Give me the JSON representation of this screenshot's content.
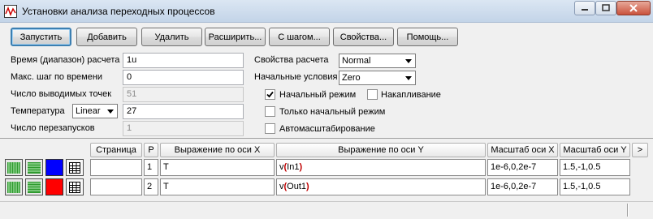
{
  "window": {
    "title": "Установки анализа переходных процессов"
  },
  "toolbar": {
    "run": "Запустить",
    "add": "Добавить",
    "delete": "Удалить",
    "expand": "Расширить...",
    "step": "С шагом...",
    "properties": "Свойства...",
    "help": "Помощь..."
  },
  "params": {
    "time_range_label": "Время (диапазон) расчета",
    "time_range_value": "1u",
    "max_step_label": "Макс.  шаг по времени",
    "max_step_value": "0",
    "points_label": "Число выводимых точек",
    "points_value": "51",
    "temperature_label": "Температура",
    "temperature_mode": "Linear",
    "temperature_value": "27",
    "restarts_label": "Число перезапусков",
    "restarts_value": "1"
  },
  "options": {
    "calc_props_label": "Свойства расчета",
    "calc_props_value": "Normal",
    "initial_cond_label": "Начальные условия",
    "initial_cond_value": "Zero",
    "initial_mode_label": "Начальный режим",
    "initial_mode_checked": true,
    "accumulate_label": "Накапливание",
    "accumulate_checked": false,
    "only_initial_label": "Только начальный режим",
    "only_initial_checked": false,
    "autoscale_label": "Автомасштабирование",
    "autoscale_checked": false
  },
  "table": {
    "headers": {
      "page": "Страница",
      "p": "P",
      "x_expr": "Выражение по оси X",
      "y_expr": "Выражение по оси Y",
      "x_scale": "Масштаб оси X",
      "y_scale": "Масштаб оси Y",
      "more": ">"
    },
    "rows": [
      {
        "color": "#0000ff",
        "page": "",
        "p": "1",
        "x_expr": "T",
        "y_func": "v",
        "y_open": "(",
        "y_arg": "In1",
        "y_close": ")",
        "x_scale": "1e-6,0,2e-7",
        "y_scale": "1.5,-1,0.5"
      },
      {
        "color": "#ff0000",
        "page": "",
        "p": "2",
        "x_expr": "T",
        "y_func": "v",
        "y_open": "(",
        "y_arg": "Out1",
        "y_close": ")",
        "x_scale": "1e-6,0,2e-7",
        "y_scale": "1.5,-1,0.5"
      }
    ]
  },
  "icons": {
    "app": "waveform-app-icon",
    "plot_lines_vertical": "vertical-grid-icon",
    "plot_lines_horizontal": "horizontal-grid-icon",
    "table": "table-grid-icon"
  }
}
